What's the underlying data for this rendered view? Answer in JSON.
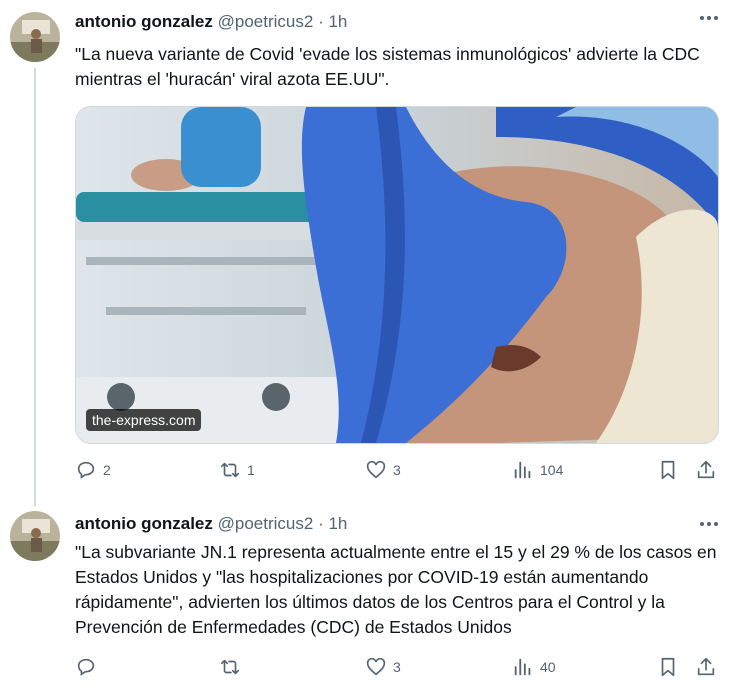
{
  "tweets": [
    {
      "author_name": "antonio gonzalez",
      "handle": "@poetricus2",
      "dot": "·",
      "time": "1h",
      "text": "\"La nueva variante de Covid 'evade los sistemas inmunológicos' advierte la CDC mientras el 'huracán' viral azota EE.UU\".",
      "media_source": "the-express.com",
      "replies": "2",
      "retweets": "1",
      "likes": "3",
      "views": "104"
    },
    {
      "author_name": "antonio gonzalez",
      "handle": "@poetricus2",
      "dot": "·",
      "time": "1h",
      "text": "\"La subvariante JN.1 representa actualmente entre el 15 y el 29 % de los casos en Estados Unidos y \"las hospitalizaciones por COVID-19 están aumentando rápidamente\", advierten los últimos datos de los Centros para el Control y la Prevención de Enfermedades (CDC) de Estados Unidos",
      "replies": "",
      "retweets": "",
      "likes": "3",
      "views": "40"
    }
  ],
  "icons": [
    "more-icon",
    "reply-icon",
    "retweet-icon",
    "like-icon",
    "views-icon",
    "bookmark-icon",
    "share-icon"
  ],
  "colors": {
    "secondary": "#536471",
    "text": "#0f1419",
    "line": "#cfd9de",
    "glove": "#3b6fd6"
  }
}
